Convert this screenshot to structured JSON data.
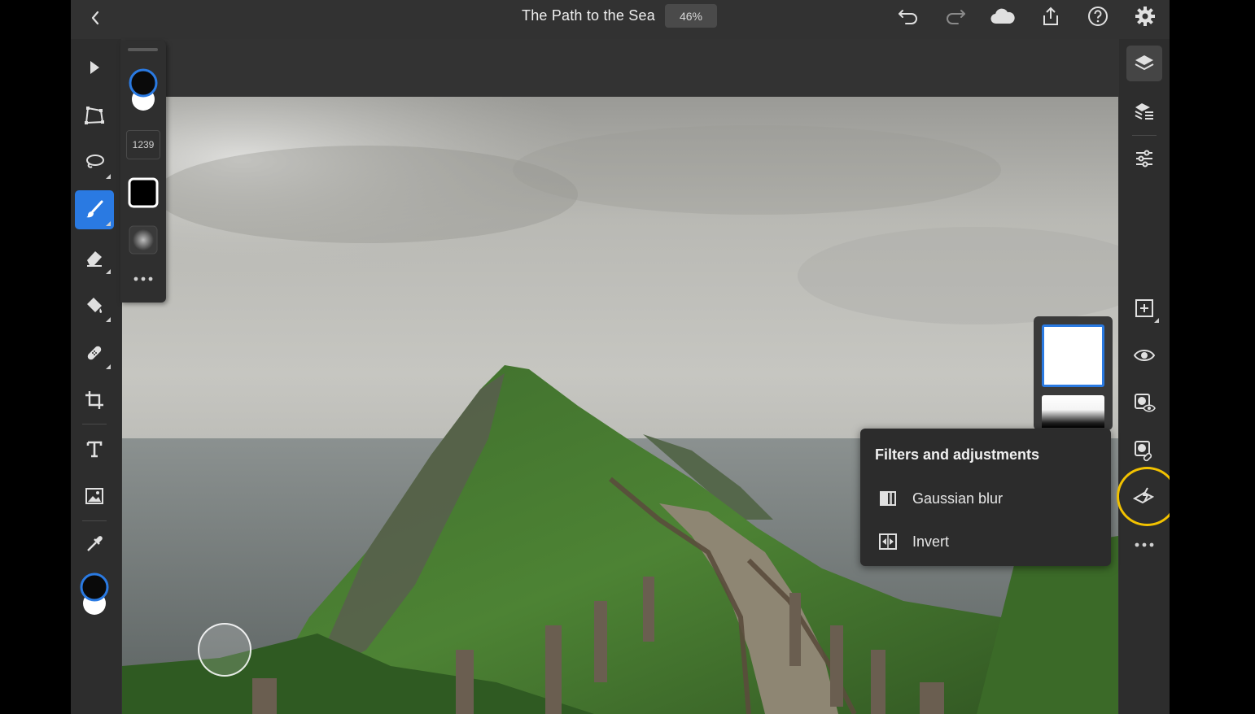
{
  "document": {
    "title": "The Path to the Sea",
    "zoom": "46%"
  },
  "tool_options": {
    "brush_size": "1239"
  },
  "popover": {
    "title": "Filters and adjustments",
    "items": [
      {
        "label": "Gaussian blur",
        "icon": "gaussian-blur-icon"
      },
      {
        "label": "Invert",
        "icon": "invert-icon"
      }
    ]
  },
  "colors": {
    "accent": "#2a7ae2",
    "highlight": "#f2c200",
    "panel": "#2d2d2d",
    "topbar": "#323232"
  }
}
